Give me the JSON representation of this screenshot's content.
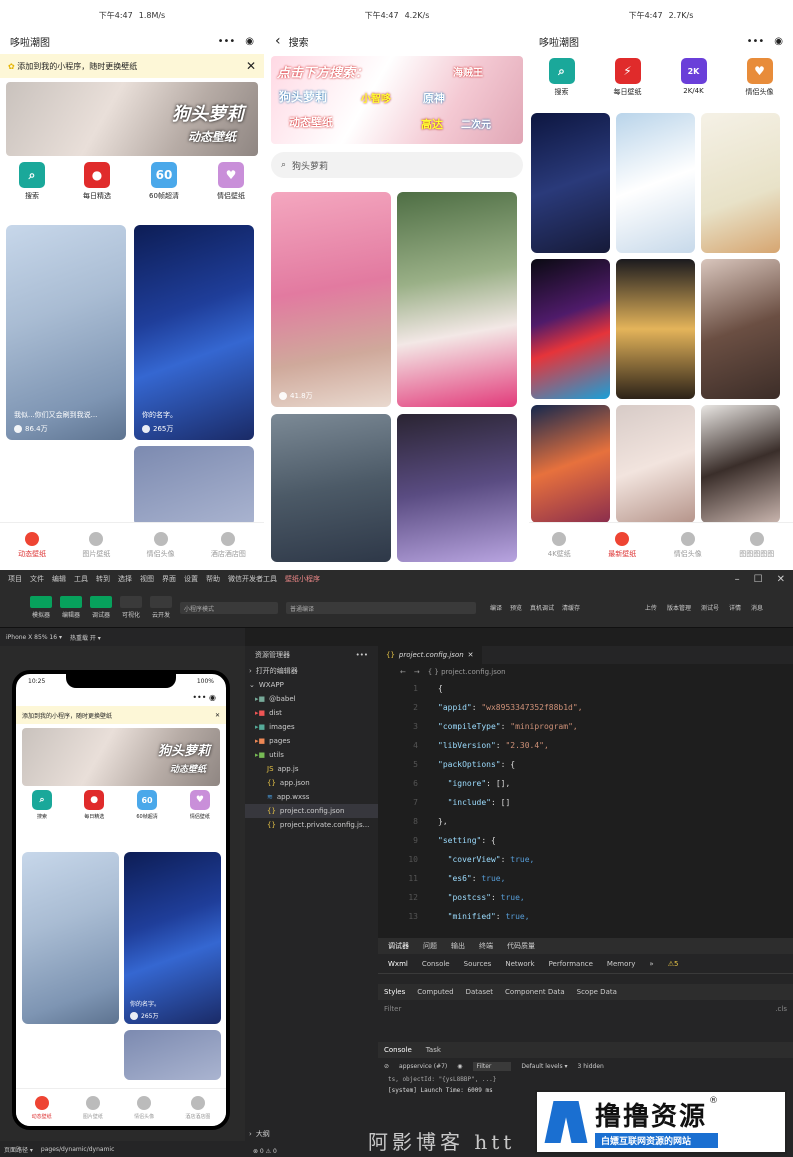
{
  "phone1": {
    "status": {
      "time": "下午4:47",
      "speed": "1.8M/s"
    },
    "title": "哆啦潮图",
    "capsule": {
      "more": "•••",
      "close": "◉"
    },
    "notice": "添加到我的小程序，随时更换壁纸",
    "notice_close": "✕",
    "banner": {
      "line1": "狗头萝莉",
      "line2": "动态壁纸"
    },
    "icons": [
      {
        "label": "搜索",
        "color": "#1aa89a"
      },
      {
        "label": "每日精选",
        "color": "#e02b2b"
      },
      {
        "label": "60帧超清",
        "color": "#4aa8ea"
      },
      {
        "label": "情侣壁纸",
        "color": "#c98fd9"
      }
    ],
    "cards": [
      {
        "caption": "我似...你们又会刷到我说...",
        "count": "86.4万"
      },
      {
        "caption": "你的名字。",
        "count": "265万"
      }
    ],
    "tabs": [
      "动态壁纸",
      "图片壁纸",
      "情侣头像",
      "酒店酒店图"
    ]
  },
  "phone2": {
    "status": {
      "time": "下午4:47",
      "speed": "4.2K/s"
    },
    "back": "‹",
    "title": "搜索",
    "banner": {
      "line1": "点击下方搜索：",
      "kw": [
        "狗头萝莉",
        "小智哆",
        "原神",
        "动态壁纸",
        "高达",
        "二次元",
        "海贼王"
      ]
    },
    "search_placeholder": "狗头萝莉",
    "card_count": "41.8万"
  },
  "phone3": {
    "status": {
      "time": "下午4:47",
      "speed": "2.7K/s"
    },
    "title": "哆啦潮图",
    "capsule": {
      "more": "•••",
      "close": "◉"
    },
    "icons": [
      {
        "label": "搜索",
        "color": "#1aa89a"
      },
      {
        "label": "每日壁纸",
        "color": "#e02b2b"
      },
      {
        "label": "2K/4K",
        "color": "#6a3fd9"
      },
      {
        "label": "情侣头像",
        "color": "#e88c3a"
      }
    ],
    "tabs": [
      "4K壁纸",
      "最新壁纸",
      "情侣头像",
      "图图图图图"
    ]
  },
  "ide": {
    "menu": [
      "项目",
      "文件",
      "编辑",
      "工具",
      "转到",
      "选择",
      "视图",
      "界面",
      "设置",
      "帮助",
      "微信开发者工具",
      "壁纸小程序"
    ],
    "toolbar": [
      {
        "label": "模拟器",
        "on": true
      },
      {
        "label": "编辑器",
        "on": true
      },
      {
        "label": "调试器",
        "on": true
      },
      {
        "label": "可视化",
        "on": false
      },
      {
        "label": "云开发",
        "on": false
      }
    ],
    "mode_select": "小程序模式",
    "compile_select": "普通编译",
    "toolbar_right": [
      "编译",
      "预览",
      "真机调试",
      "清缓存",
      "上传",
      "版本管理",
      "测试号",
      "详情",
      "消息"
    ],
    "device": "iPhone X 85% 16 ▾",
    "hot": "热重载 开 ▾",
    "sim_time": "10:25",
    "sim_battery": "100%",
    "explorer_title": "资源管理器",
    "open_editors": "打开的编辑器",
    "root": "WXAPP",
    "files": [
      {
        "name": "@babel",
        "type": "folder"
      },
      {
        "name": "dist",
        "type": "folder"
      },
      {
        "name": "images",
        "type": "folder"
      },
      {
        "name": "pages",
        "type": "folder"
      },
      {
        "name": "utils",
        "type": "folder"
      },
      {
        "name": "app.js",
        "type": "js"
      },
      {
        "name": "app.json",
        "type": "json"
      },
      {
        "name": "app.wxss",
        "type": "wxss"
      },
      {
        "name": "project.config.json",
        "type": "json"
      },
      {
        "name": "project.private.config.js...",
        "type": "json"
      }
    ],
    "outline": "大纲",
    "statusbar": {
      "path": "页面路径 ▾",
      "page": "pages/dynamic/dynamic",
      "errors": "⊗ 0 ⚠ 0"
    },
    "editor_tab": "project.config.json",
    "breadcrumb": "{ } project.config.json",
    "code": [
      {
        "n": "1",
        "t": "{"
      },
      {
        "n": "2",
        "k": "\"appid\"",
        "v": "\"wx8953347352f88b1d\","
      },
      {
        "n": "3",
        "k": "\"compileType\"",
        "v": "\"miniprogram\","
      },
      {
        "n": "4",
        "k": "\"libVersion\"",
        "v": "\"2.30.4\","
      },
      {
        "n": "5",
        "k": "\"packOptions\"",
        "v": "{"
      },
      {
        "n": "6",
        "k": "  \"ignore\"",
        "v": "[],"
      },
      {
        "n": "7",
        "k": "  \"include\"",
        "v": "[]"
      },
      {
        "n": "8",
        "t": "},"
      },
      {
        "n": "9",
        "k": "\"setting\"",
        "v": "{"
      },
      {
        "n": "10",
        "k": "  \"coverView\"",
        "v": "true,"
      },
      {
        "n": "11",
        "k": "  \"es6\"",
        "v": "true,"
      },
      {
        "n": "12",
        "k": "  \"postcss\"",
        "v": "true,"
      },
      {
        "n": "13",
        "k": "  \"minified\"",
        "v": "true,"
      }
    ],
    "devtools_tabs": [
      "调试器",
      "问题",
      "输出",
      "终端",
      "代码质量"
    ],
    "panel_tabs": [
      "Wxml",
      "Console",
      "Sources",
      "Network",
      "Performance",
      "Memory",
      "»",
      "⚠5"
    ],
    "style_tabs": [
      "Styles",
      "Computed",
      "Dataset",
      "Component Data",
      "Scope Data"
    ],
    "filter": "Filter",
    "cls": ".cls",
    "console_tabs": [
      "Console",
      "Task"
    ],
    "console_ctx": "appservice (#7)",
    "console_filter": "Filter",
    "levels": "Default levels ▾",
    "hidden": "3 hidden",
    "log1": "ts, objectId: \"{ysL8BBP\", ...}",
    "log2": "[system] Launch Time: 6009 ms"
  },
  "watermark": {
    "text": "阿影博客 htt"
  },
  "logo": {
    "title": "撸撸资源",
    "sub": "白嫖互联网资源的网站",
    "reg": "®"
  }
}
